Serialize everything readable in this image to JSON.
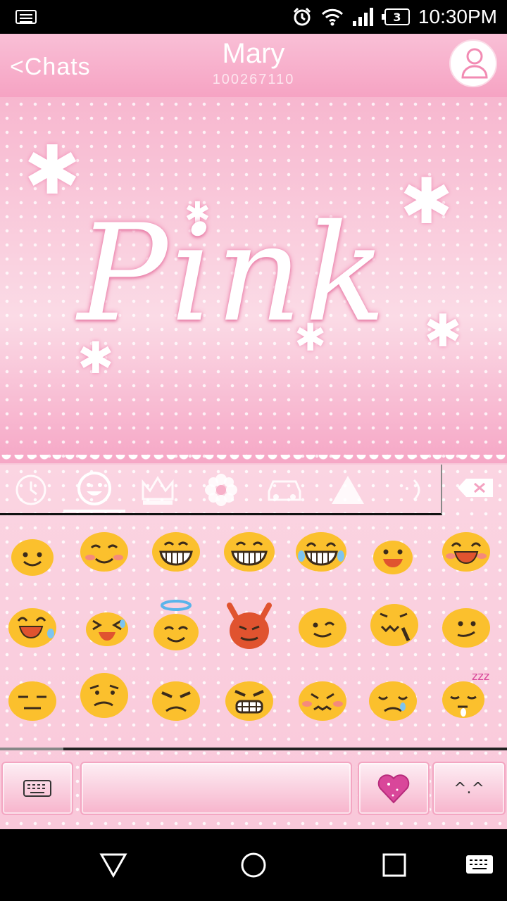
{
  "status_bar": {
    "time": "10:30PM",
    "battery_level": "3",
    "icons": [
      "keyboard-icon",
      "alarm-icon",
      "wifi-icon",
      "signal-icon",
      "battery-icon"
    ]
  },
  "header": {
    "back_label": "<Chats",
    "contact_name": "Mary",
    "contact_id": "100267110"
  },
  "wallpaper": {
    "text": "Pink"
  },
  "emoji_tabs": [
    {
      "name": "recent",
      "icon": "clock-icon"
    },
    {
      "name": "smileys",
      "icon": "smiley-icon",
      "active": true
    },
    {
      "name": "objects",
      "icon": "crown-icon"
    },
    {
      "name": "nature",
      "icon": "flower-icon"
    },
    {
      "name": "places",
      "icon": "car-icon"
    },
    {
      "name": "symbols",
      "icon": "triangle-icon"
    },
    {
      "name": "emoticons",
      "icon": "emoticon-icon"
    }
  ],
  "emojis": [
    [
      "smile",
      "blush",
      "grin",
      "grinning",
      "joy",
      "happy",
      "laughing"
    ],
    [
      "sweat-smile",
      "squint-laugh",
      "innocent",
      "imp",
      "wink",
      "confounded",
      "neutral-smile"
    ],
    [
      "expressionless",
      "confused",
      "angry",
      "grimace",
      "pouting",
      "sad",
      "sleepy"
    ]
  ],
  "bottom_keys": {
    "keyboard_key": "keyboard-icon",
    "space_key": "",
    "heart_key": "heart-icon",
    "emoticon_key": "^.^"
  },
  "colors": {
    "accent": "#f6a3c3",
    "emoji_yellow": "#fbc02d",
    "emoji_red": "#e0532f"
  }
}
